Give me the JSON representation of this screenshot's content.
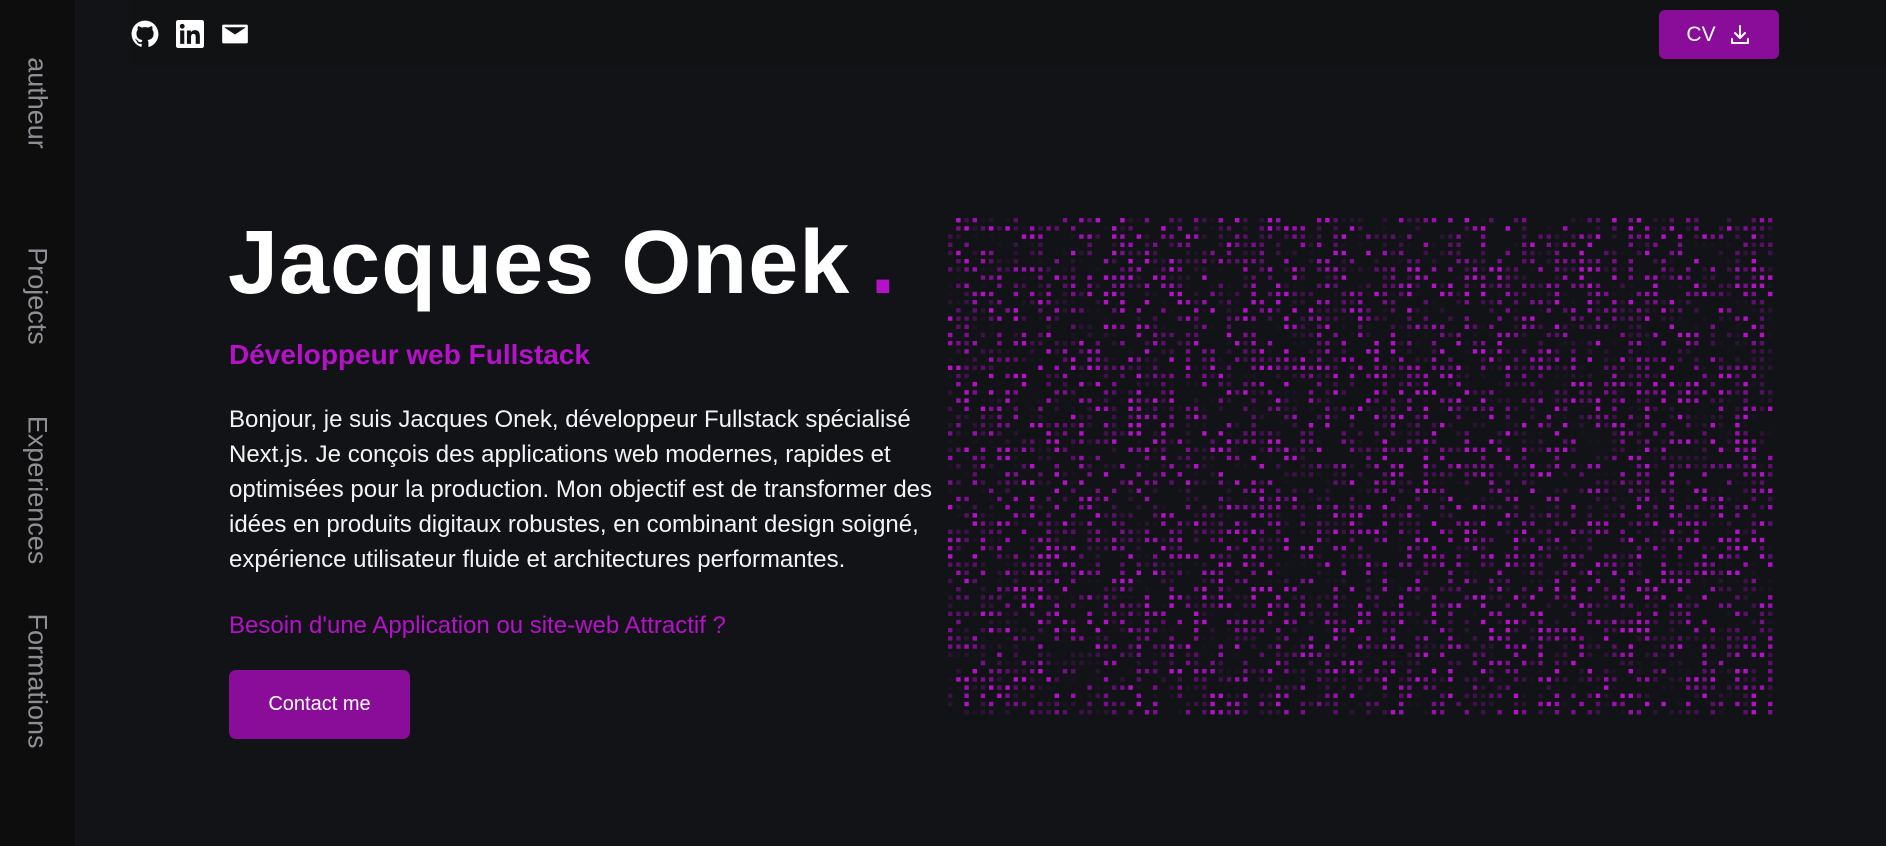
{
  "sidebar": {
    "items": [
      {
        "label": "autheur"
      },
      {
        "label": "Projects"
      },
      {
        "label": "Experiences"
      },
      {
        "label": "Formations"
      }
    ]
  },
  "topbar": {
    "icons": [
      "github-icon",
      "linkedin-icon",
      "mail-icon"
    ],
    "cv_label": "CV",
    "cv_icon": "download-icon"
  },
  "hero": {
    "name": "Jacques Onek",
    "dot": ".",
    "role": "Développeur web Fullstack",
    "bio": "Bonjour, je suis Jacques Onek, développeur Fullstack spécialisé Next.js. Je conçois des applications web modernes, rapides et optimisées pour la production. Mon objectif est de transformer des idées en produits digitaux robustes, en combinant design soigné, expérience utilisateur fluide et architectures performantes.",
    "cta_text": "Besoin d'une Application ou site-web Attractif ?",
    "contact_label": "Contact me"
  },
  "colors": {
    "accent": "#b511c9",
    "button": "#8a0d9a",
    "background": "#121316",
    "sidebar": "#0d0d0e"
  }
}
